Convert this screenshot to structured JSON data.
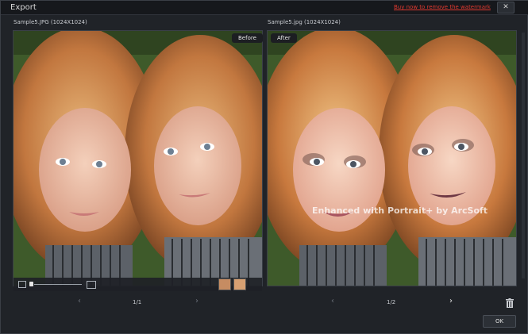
{
  "window": {
    "title": "Export",
    "watermark_link": "Buy now to remove the watermark",
    "close_label": "✕"
  },
  "left": {
    "filename": "Sample5.JPG (1024X1024)",
    "tag": "Before",
    "pager": {
      "prev": "‹",
      "next": "›",
      "page": "1/1"
    }
  },
  "right": {
    "filename": "Sample5.jpg (1024X1024)",
    "tag": "After",
    "watermark_text": "Enhanced with Portrait+ by ArcSoft",
    "pager": {
      "prev": "‹",
      "next": "›",
      "page": "1/2"
    }
  },
  "footer": {
    "ok_label": "OK"
  },
  "icons": {
    "close": "close-icon",
    "zoom_out": "image-small-icon",
    "zoom_in": "image-large-icon",
    "delete": "trash-icon"
  },
  "colors": {
    "link": "#e0392f",
    "background": "#202328"
  }
}
